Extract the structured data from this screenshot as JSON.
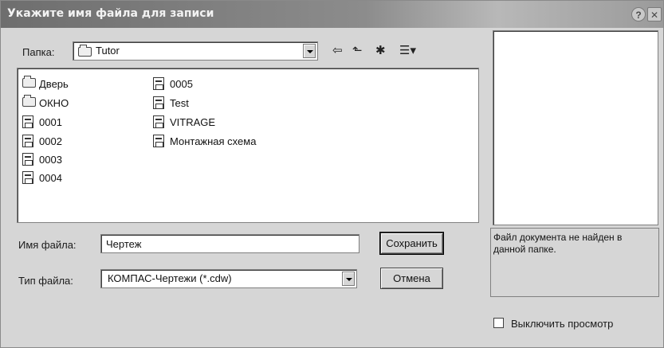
{
  "dialog": {
    "title": "Укажите имя файла для записи",
    "help_label": "?",
    "close_label": "✕"
  },
  "folder": {
    "label": "Папка:",
    "value": "Tutor"
  },
  "toolbar": {
    "back_icon": "⇦",
    "up_icon": "⬑",
    "new_folder_icon": "✱",
    "view_icon": "☰▾"
  },
  "files": {
    "column1": [
      {
        "name": "Дверь",
        "type": "folder"
      },
      {
        "name": "ОКНО",
        "type": "folder"
      },
      {
        "name": "0001",
        "type": "document"
      },
      {
        "name": "0002",
        "type": "document"
      },
      {
        "name": "0003",
        "type": "document"
      },
      {
        "name": "0004",
        "type": "document"
      }
    ],
    "column2": [
      {
        "name": "0005",
        "type": "document"
      },
      {
        "name": "Test",
        "type": "document"
      },
      {
        "name": "VITRAGE",
        "type": "document"
      },
      {
        "name": "Монтажная схема",
        "type": "document"
      }
    ]
  },
  "filename": {
    "label": "Имя файла:",
    "value": "Чертеж"
  },
  "filetype": {
    "label": "Тип файла:",
    "value": "КОМПАС-Чертежи (*.cdw)"
  },
  "buttons": {
    "save": "Сохранить",
    "cancel": "Отмена"
  },
  "preview": {
    "message": "Файл документа не найден в данной папке.",
    "disable_preview_label": "Выключить просмотр"
  }
}
